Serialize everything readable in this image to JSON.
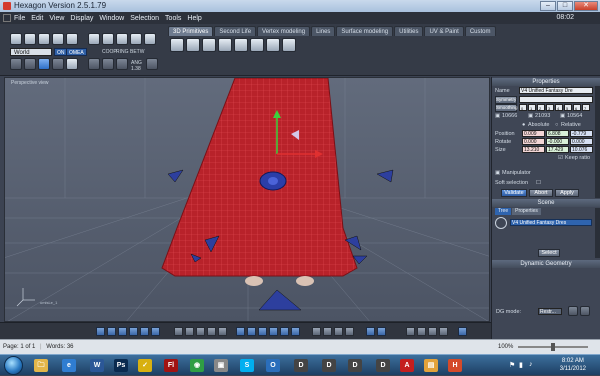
{
  "window": {
    "title": "Hexagon Version 2.5.1.79",
    "controls": [
      "minimize",
      "maximize",
      "close"
    ]
  },
  "menu": {
    "items": [
      "File",
      "Edit",
      "View",
      "Display",
      "Window",
      "Selection",
      "Tools",
      "Help"
    ],
    "clock": "08:02"
  },
  "toolbar": {
    "world_select": "World",
    "mode_buttons": [
      "ON",
      "OMEA"
    ],
    "group_labels": [
      "COOP",
      "RING",
      "BETW",
      "ANG",
      "1.38"
    ]
  },
  "tabs": [
    {
      "label": "3D Primitives",
      "active": true
    },
    {
      "label": "Second Life",
      "active": false
    },
    {
      "label": "Vertex modeling",
      "active": false
    },
    {
      "label": "Lines",
      "active": false
    },
    {
      "label": "Surface modeling",
      "active": false
    },
    {
      "label": "Utilities",
      "active": false
    },
    {
      "label": "UV & Paint",
      "active": false
    },
    {
      "label": "Custom",
      "active": false
    }
  ],
  "viewport": {
    "label": "Perspective view",
    "coord_label": "umlsLe_1"
  },
  "properties": {
    "header": "Properties",
    "name_label": "Name",
    "name_value": "V4 Unified Fantasy Dre",
    "symmetry_label": "Symmetry",
    "smoothing_label": "Smoothing",
    "smoothing_levels": [
      "0",
      "1",
      "2",
      "3",
      "4",
      "5",
      "6",
      "7"
    ],
    "counts": [
      "10666",
      "21093",
      "10564"
    ],
    "absolute_label": "Absolute",
    "relative_label": "Relative",
    "position_label": "Position",
    "position": [
      "0.009",
      "6.808",
      "-0.779"
    ],
    "rotate_label": "Rotate",
    "rotate": [
      "0.000",
      "-0.000",
      "0.000"
    ],
    "size_label": "Size",
    "size": [
      "13.210",
      "17.429",
      "10.076"
    ],
    "keep_ratio": "Keep ratio",
    "manipulator": "Manipulator",
    "soft_selection": "Soft selection",
    "buttons": [
      "Validate",
      "Abort",
      "Apply"
    ]
  },
  "scene": {
    "header": "Scene",
    "tabs": [
      "Tree",
      "Properties"
    ],
    "item": "V4 Unified Fantasy Dres",
    "select_button": "Select"
  },
  "dynamic_geometry": {
    "header": "Dynamic Geometry",
    "dg_mode_label": "DG mode:",
    "dg_mode_value": "Restr..."
  },
  "statusbar": {
    "page": "Page: 1 of 1",
    "words": "Words: 36",
    "zoom": "100%"
  },
  "taskbar": {
    "time": "8:02 AM",
    "date": "3/11/2012",
    "apps": [
      {
        "name": "explorer-icon",
        "glyph": "🗀",
        "color": "#e2b64a"
      },
      {
        "name": "ie-icon",
        "glyph": "e",
        "color": "#2f7dd1"
      },
      {
        "name": "word-icon",
        "glyph": "W",
        "color": "#2b5797"
      },
      {
        "name": "photoshop-icon",
        "glyph": "Ps",
        "color": "#0a2a4f"
      },
      {
        "name": "norton-icon",
        "glyph": "✓",
        "color": "#d8b010"
      },
      {
        "name": "flash-icon",
        "glyph": "Fl",
        "color": "#a11313"
      },
      {
        "name": "chrome-icon",
        "glyph": "◉",
        "color": "#2f9e44"
      },
      {
        "name": "app-icon",
        "glyph": "▣",
        "color": "#888"
      },
      {
        "name": "skype-icon",
        "glyph": "S",
        "color": "#00aff0"
      },
      {
        "name": "outlook-icon",
        "glyph": "O",
        "color": "#2a6ebb"
      },
      {
        "name": "daz-icon",
        "glyph": "D",
        "color": "#444"
      },
      {
        "name": "daz2-icon",
        "glyph": "D",
        "color": "#444"
      },
      {
        "name": "daz3-icon",
        "glyph": "D",
        "color": "#444"
      },
      {
        "name": "daz4-icon",
        "glyph": "D",
        "color": "#444"
      },
      {
        "name": "acrobat-icon",
        "glyph": "A",
        "color": "#c41e1e"
      },
      {
        "name": "folder-icon",
        "glyph": "▤",
        "color": "#e2a23a"
      },
      {
        "name": "hexagon-icon",
        "glyph": "H",
        "color": "#d44a2a"
      }
    ]
  }
}
